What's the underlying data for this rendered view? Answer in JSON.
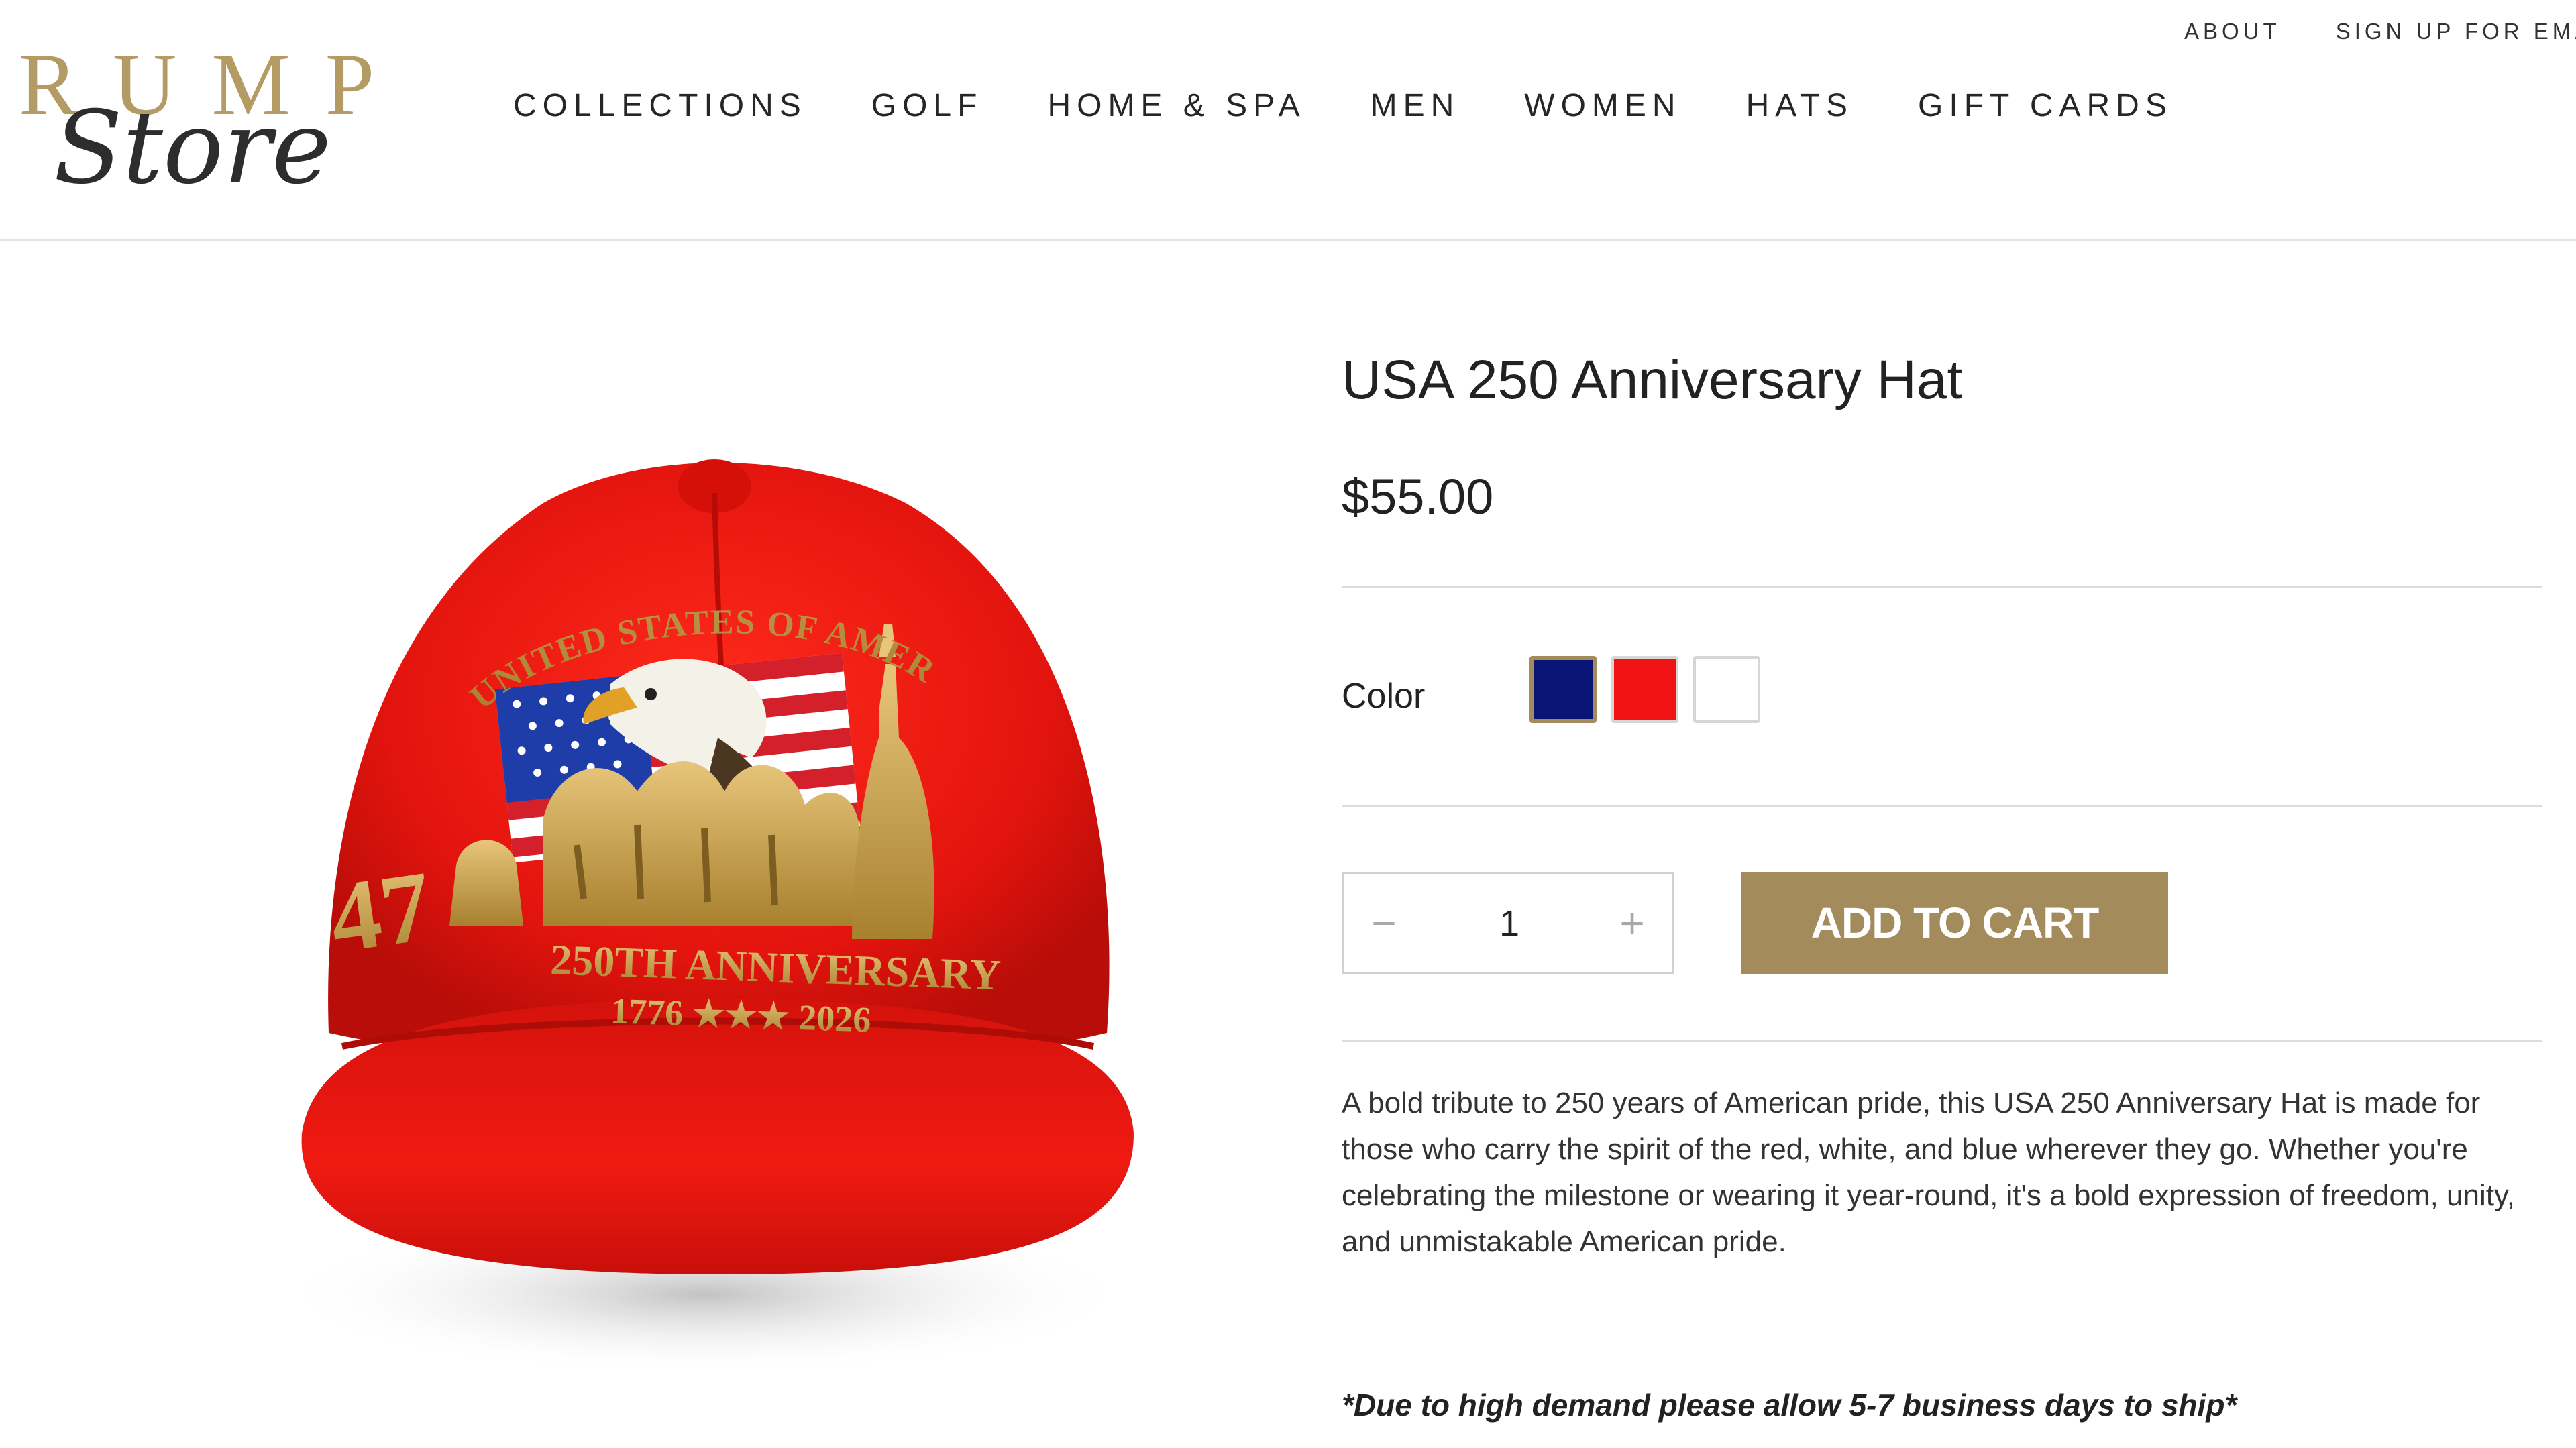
{
  "header": {
    "logo_main": "RUMP",
    "logo_script": "Store",
    "util_nav": [
      "ABOUT",
      "SIGN UP FOR EMAI"
    ],
    "main_nav": [
      "COLLECTIONS",
      "GOLF",
      "HOME & SPA",
      "MEN",
      "WOMEN",
      "HATS",
      "GIFT CARDS"
    ]
  },
  "product": {
    "title": "USA 250 Anniversary Hat",
    "price": "$55.00",
    "color_label": "Color",
    "colors": [
      {
        "name": "navy",
        "hex": "#0b1477",
        "selected": true
      },
      {
        "name": "red",
        "hex": "#f01414",
        "selected": false
      },
      {
        "name": "white",
        "hex": "#ffffff",
        "selected": false
      }
    ],
    "quantity": "1",
    "qty_minus": "−",
    "qty_plus": "+",
    "add_to_cart_label": "ADD TO CART",
    "description": "A bold tribute to 250 years of American pride, this USA 250 Anniversary Hat is made for those who carry the spirit of the red, white, and blue wherever they go. Whether you're celebrating the milestone or wearing it year-round, it's a bold expression of freedom, unity, and unmistakable American pride.",
    "shipping_note": "*Due to high demand please allow 5-7 business days to ship*",
    "image": {
      "arc_text": "UNITED STATES OF AMERICA",
      "anniversary_text": "250TH ANNIVERSARY",
      "years_text": "1776 ★★★ 2026",
      "side_text": "47"
    }
  },
  "colors": {
    "accent": "#a38b5c",
    "hat_red": "#e8150f",
    "gold": "#c9a24a"
  }
}
